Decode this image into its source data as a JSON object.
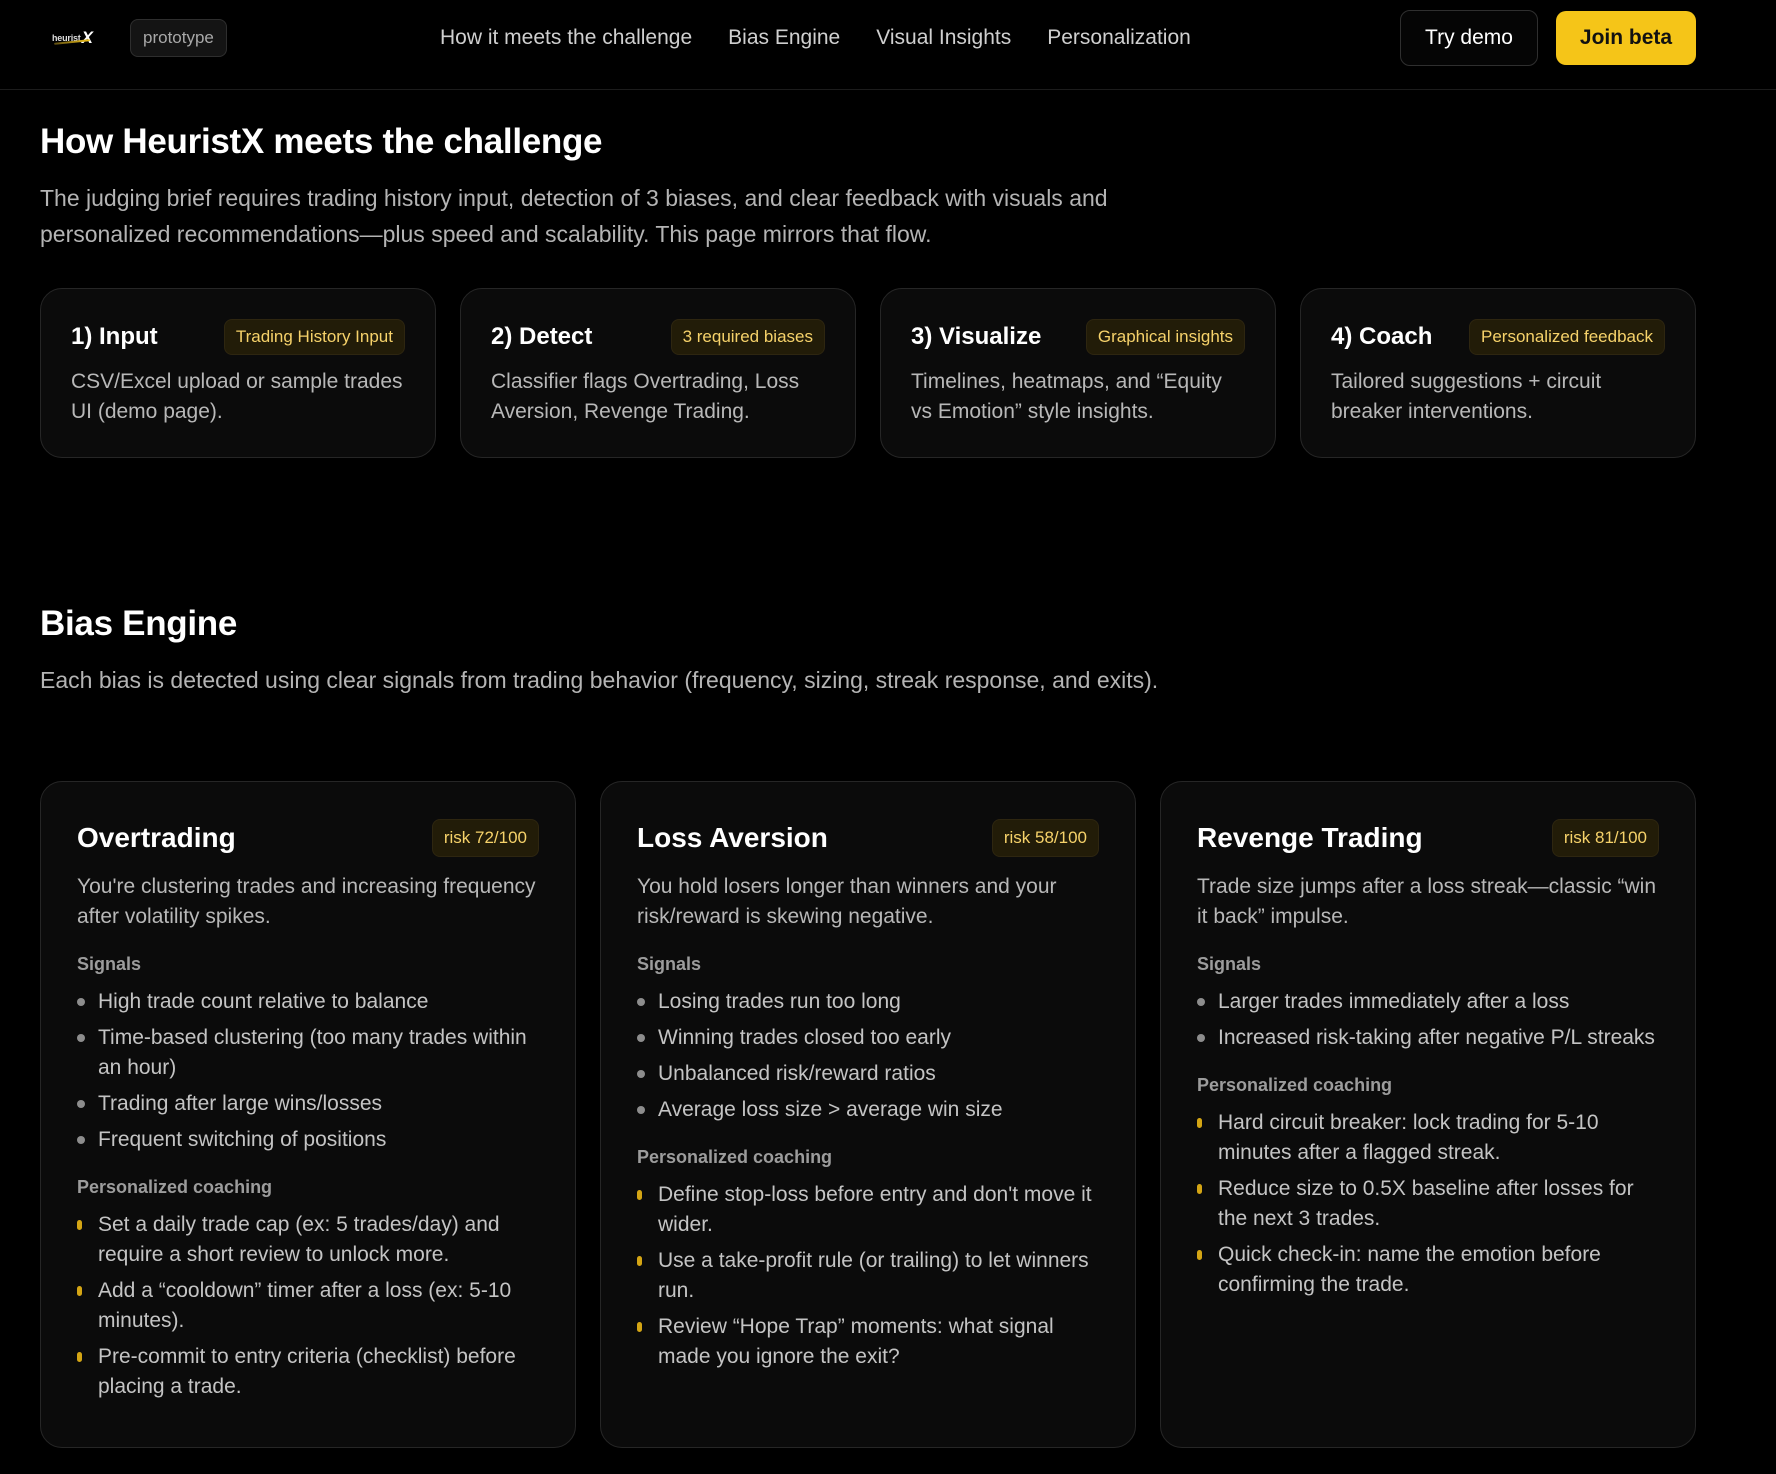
{
  "header": {
    "logo_text": "heurist",
    "logo_mark": "X",
    "badge": "prototype",
    "nav": [
      {
        "label": "How it meets the challenge"
      },
      {
        "label": "Bias Engine"
      },
      {
        "label": "Visual Insights"
      },
      {
        "label": "Personalization"
      }
    ],
    "try_demo": "Try demo",
    "join_beta": "Join beta"
  },
  "challenge": {
    "title": "How HeuristX meets the challenge",
    "lead": "The judging brief requires trading history input, detection of 3 biases, and clear feedback with visuals and personalized recommendations—plus speed and scalability. This page mirrors that flow.",
    "steps": [
      {
        "title": "1) Input",
        "tag": "Trading History Input",
        "desc": "CSV/Excel upload or sample trades UI (demo page)."
      },
      {
        "title": "2) Detect",
        "tag": "3 required biases",
        "desc": "Classifier flags Overtrading, Loss Aversion, Revenge Trading."
      },
      {
        "title": "3) Visualize",
        "tag": "Graphical insights",
        "desc": "Timelines, heatmaps, and “Equity vs Emotion” style insights."
      },
      {
        "title": "4) Coach",
        "tag": "Personalized feedback",
        "desc": "Tailored suggestions + circuit breaker interventions."
      }
    ]
  },
  "bias_engine": {
    "title": "Bias Engine",
    "lead": "Each bias is detected using clear signals from trading behavior (frequency, sizing, streak response, and exits).",
    "signals_label": "Signals",
    "coaching_label": "Personalized coaching",
    "cards": [
      {
        "title": "Overtrading",
        "risk": "risk 72/100",
        "desc": "You're clustering trades and increasing frequency after volatility spikes.",
        "signals": [
          "High trade count relative to balance",
          "Time-based clustering (too many trades within an hour)",
          "Trading after large wins/losses",
          "Frequent switching of positions"
        ],
        "coaching": [
          "Set a daily trade cap (ex: 5 trades/day) and require a short review to unlock more.",
          "Add a “cooldown” timer after a loss (ex: 5-10 minutes).",
          "Pre-commit to entry criteria (checklist) before placing a trade."
        ]
      },
      {
        "title": "Loss Aversion",
        "risk": "risk 58/100",
        "desc": "You hold losers longer than winners and your risk/reward is skewing negative.",
        "signals": [
          "Losing trades run too long",
          "Winning trades closed too early",
          "Unbalanced risk/reward ratios",
          "Average loss size > average win size"
        ],
        "coaching": [
          "Define stop-loss before entry and don't move it wider.",
          "Use a take-profit rule (or trailing) to let winners run.",
          "Review “Hope Trap” moments: what signal made you ignore the exit?"
        ]
      },
      {
        "title": "Revenge Trading",
        "risk": "risk 81/100",
        "desc": "Trade size jumps after a loss streak—classic “win it back” impulse.",
        "signals": [
          "Larger trades immediately after a loss",
          "Increased risk-taking after negative P/L streaks"
        ],
        "coaching": [
          "Hard circuit breaker: lock trading for 5-10 minutes after a flagged streak.",
          "Reduce size to 0.5X baseline after losses for the next 3 trades.",
          "Quick check-in: name the emotion before confirming the trade."
        ]
      }
    ]
  }
}
